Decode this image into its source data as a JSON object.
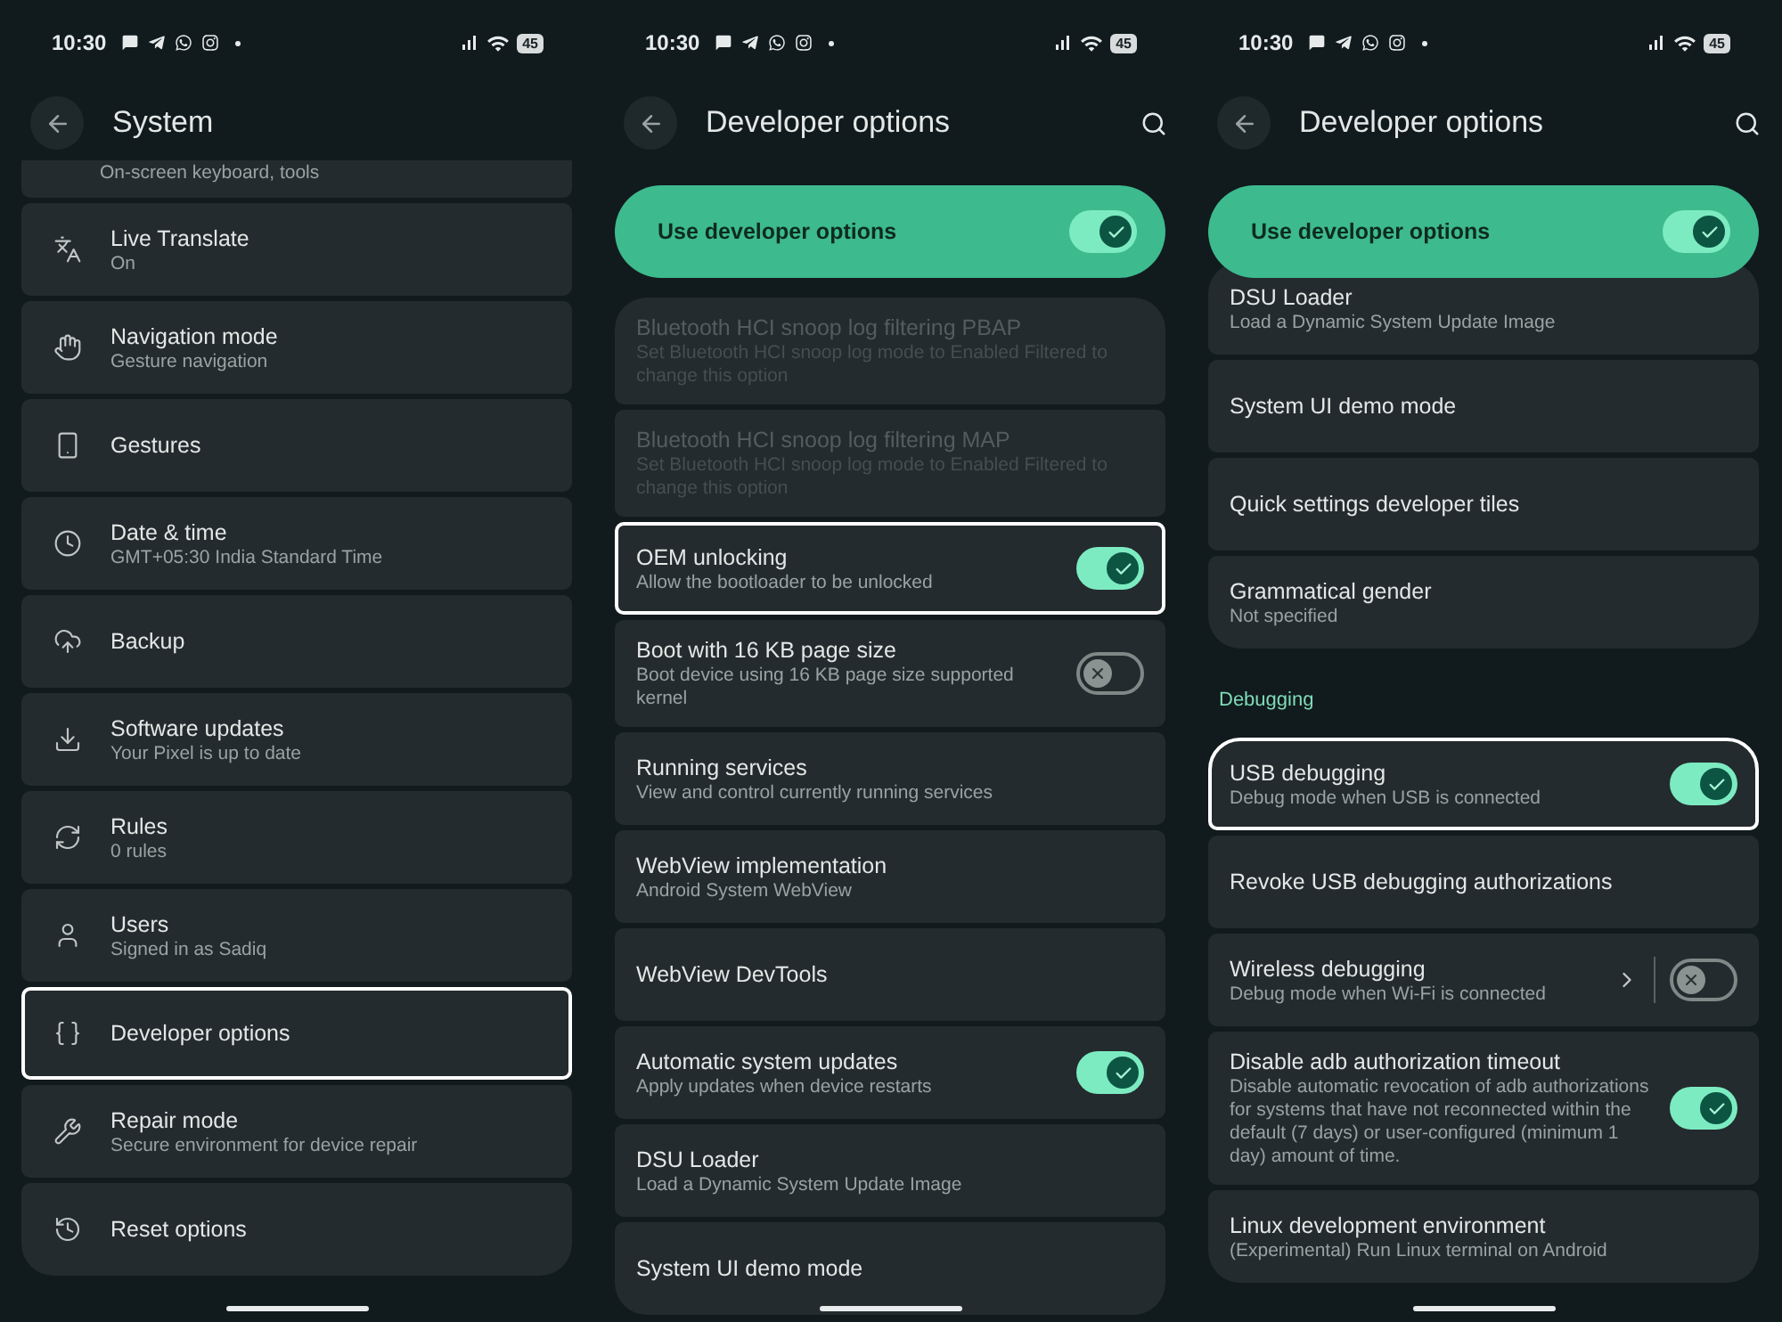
{
  "panels": [
    {
      "status_bar": {
        "time": "10:30",
        "battery": "45"
      },
      "header": {
        "title": "System",
        "search": false
      },
      "items": [
        {
          "kind": "link",
          "subtitle": "On-screen keyboard, tools",
          "highlighted": false
        },
        {
          "kind": "link",
          "title": "Live Translate",
          "subtitle": "On",
          "highlighted": false
        },
        {
          "kind": "link",
          "title": "Navigation mode",
          "subtitle": "Gesture navigation",
          "highlighted": false
        },
        {
          "kind": "link",
          "title": "Gestures",
          "highlighted": false
        },
        {
          "kind": "link",
          "title": "Date & time",
          "subtitle": "GMT+05:30 India Standard Time",
          "highlighted": false
        },
        {
          "kind": "link",
          "title": "Backup",
          "highlighted": false
        },
        {
          "kind": "link",
          "title": "Software updates",
          "subtitle": "Your Pixel is up to date",
          "highlighted": false
        },
        {
          "kind": "link",
          "title": "Rules",
          "subtitle": "0 rules",
          "highlighted": false
        },
        {
          "kind": "link",
          "title": "Users",
          "subtitle": "Signed in as Sadiq",
          "highlighted": false
        },
        {
          "kind": "link",
          "title": "Developer options",
          "highlighted": true
        },
        {
          "kind": "link",
          "title": "Repair mode",
          "subtitle": "Secure environment for device repair",
          "highlighted": false
        },
        {
          "kind": "link",
          "title": "Reset options",
          "highlighted": false
        }
      ]
    },
    {
      "status_bar": {
        "time": "10:30",
        "battery": "45"
      },
      "header": {
        "title": "Developer options",
        "search": true
      },
      "master": {
        "label": "Use developer options",
        "on": true
      },
      "items": [
        {
          "kind": "link",
          "title": "Bluetooth HCI snoop log filtering PBAP",
          "subtitle": "Set Bluetooth HCI snoop log mode to Enabled Filtered to change this option",
          "highlighted": false,
          "disabled": true
        },
        {
          "kind": "link",
          "title": "Bluetooth HCI snoop log filtering MAP",
          "subtitle": "Set Bluetooth HCI snoop log mode to Enabled Filtered to change this option",
          "highlighted": false,
          "disabled": true
        },
        {
          "kind": "switch",
          "title": "OEM unlocking",
          "subtitle": "Allow the bootloader to be unlocked",
          "on": true,
          "highlighted": true,
          "disabled": false
        },
        {
          "kind": "switch",
          "title": "Boot with 16 KB page size",
          "subtitle": "Boot device using 16 KB page size supported kernel",
          "on": false,
          "highlighted": false,
          "disabled": false
        },
        {
          "kind": "link",
          "title": "Running services",
          "subtitle": "View and control currently running services",
          "highlighted": false,
          "disabled": false
        },
        {
          "kind": "link",
          "title": "WebView implementation",
          "subtitle": "Android System WebView",
          "highlighted": false,
          "disabled": false
        },
        {
          "kind": "link",
          "title": "WebView DevTools",
          "highlighted": false,
          "disabled": false
        },
        {
          "kind": "switch",
          "title": "Automatic system updates",
          "subtitle": "Apply updates when device restarts",
          "on": true,
          "highlighted": false,
          "disabled": false
        },
        {
          "kind": "link",
          "title": "DSU Loader",
          "subtitle": "Load a Dynamic System Update Image",
          "highlighted": false,
          "disabled": false
        },
        {
          "kind": "link",
          "title": "System UI demo mode",
          "highlighted": false,
          "disabled": false
        }
      ]
    },
    {
      "status_bar": {
        "time": "10:30",
        "battery": "45"
      },
      "header": {
        "title": "Developer options",
        "search": true
      },
      "master": {
        "label": "Use developer options",
        "on": true
      },
      "items": [
        {
          "kind": "link",
          "title": "DSU Loader",
          "subtitle": "Load a Dynamic System Update Image",
          "highlighted": false
        },
        {
          "kind": "link",
          "title": "System UI demo mode",
          "highlighted": false
        },
        {
          "kind": "link",
          "title": "Quick settings developer tiles",
          "highlighted": false
        },
        {
          "kind": "link",
          "title": "Grammatical gender",
          "subtitle": "Not specified",
          "highlighted": false
        },
        {
          "kind": "section",
          "title": "Debugging"
        },
        {
          "kind": "switch",
          "title": "USB debugging",
          "subtitle": "Debug mode when USB is connected",
          "on": true,
          "highlighted": true
        },
        {
          "kind": "link",
          "title": "Revoke USB debugging authorizations",
          "highlighted": false
        },
        {
          "kind": "split_switch",
          "title": "Wireless debugging",
          "subtitle": "Debug mode when Wi-Fi is connected",
          "on": false,
          "highlighted": false
        },
        {
          "kind": "switch",
          "title": "Disable adb authorization timeout",
          "subtitle": "Disable automatic revocation of adb authorizations for systems that have not reconnected within the default (7 days) or user-configured (minimum 1 day) amount of time.",
          "on": true,
          "highlighted": false
        },
        {
          "kind": "link",
          "title": "Linux development environment",
          "subtitle": "(Experimental) Run Linux terminal on Android",
          "highlighted": false
        }
      ]
    }
  ]
}
